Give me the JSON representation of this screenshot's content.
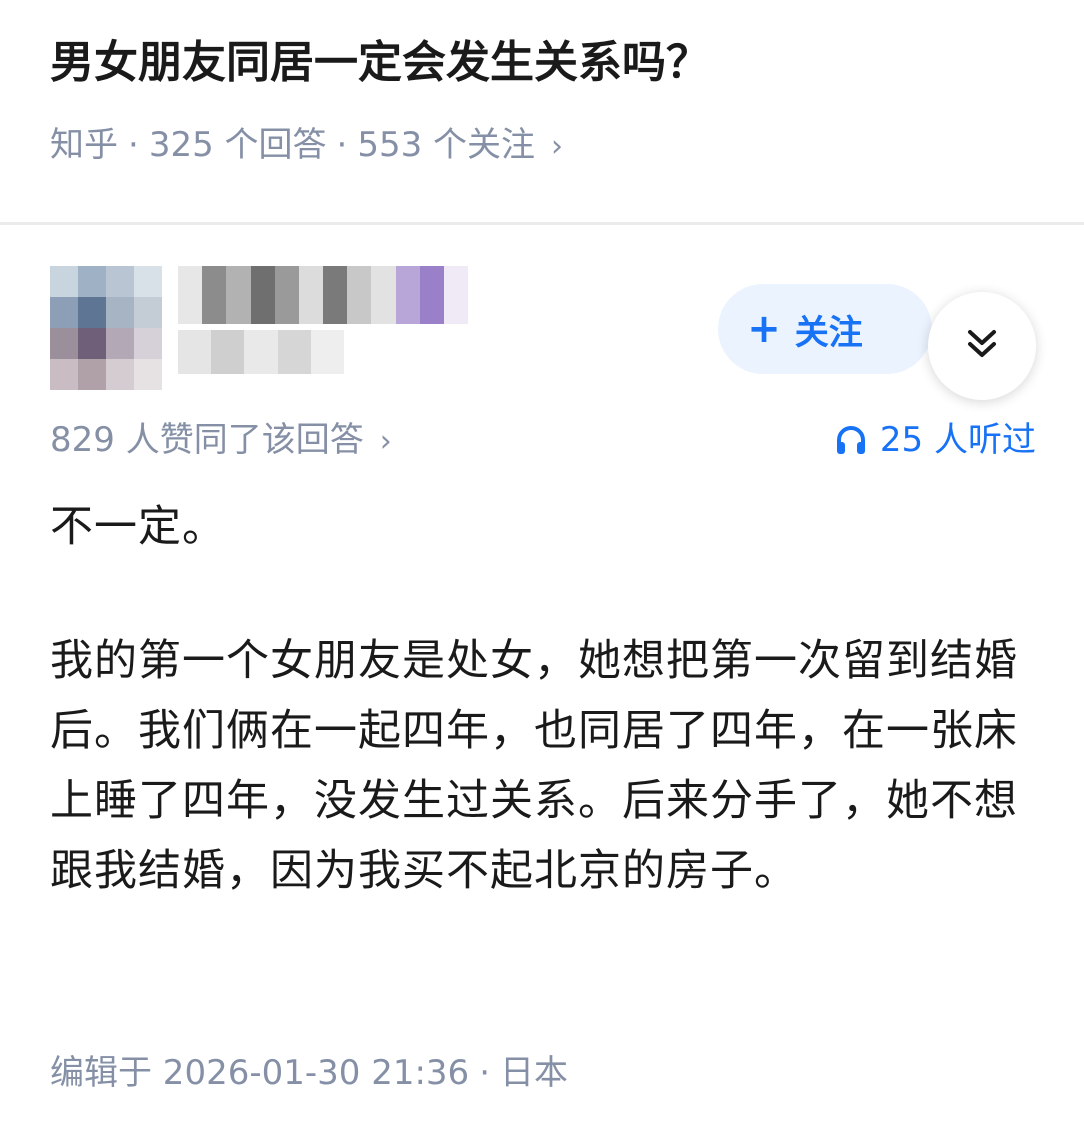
{
  "question": {
    "title": "男女朋友同居一定会发生关系吗？",
    "source": "知乎",
    "answers_count": "325 个回答",
    "followers_count": "553 个关注",
    "separator": "·",
    "chevron": "›"
  },
  "author": {
    "avatar_palette": [
      "#c8d4de",
      "#9fb1c4",
      "#b9c5d2",
      "#d9e1e8",
      "#8c9fb6",
      "#5f7594",
      "#a7b4c4",
      "#c4ccd6",
      "#9b8f9c",
      "#6f5f78",
      "#b3a8b6",
      "#d6d0d8",
      "#c9bcc2",
      "#b0a0a8",
      "#d4ccd0",
      "#e6e2e4"
    ],
    "name_palette": [
      "#e7e7e7",
      "#8c8c8c",
      "#b2b2b2",
      "#6f6f6f",
      "#9a9a9a",
      "#dcdcdc",
      "#7a7a7a",
      "#c8c8c8",
      "#e2e2e2",
      "#b9a6d9",
      "#9a7fc9",
      "#efeaf6"
    ],
    "sub_palette": [
      "#e5e5e5",
      "#cfcfcf",
      "#e9e9e9",
      "#d6d6d6",
      "#eeeeee"
    ]
  },
  "follow_button": {
    "plus": "+",
    "label": "关注",
    "text_color": "#1772f6",
    "bg_color": "#ebf3ff"
  },
  "expand_button": {
    "icon": "chevrons-down-icon"
  },
  "upvote": {
    "text": "829 人赞同了该回答",
    "chevron": "›"
  },
  "listen": {
    "icon": "headphones-icon",
    "text": "25 人听过"
  },
  "answer": {
    "paragraphs": [
      "不一定。",
      "我的第一个女朋友是处女，她想把第一次留到结婚后。我们俩在一起四年，也同居了四年，在一张床上睡了四年，没发生过关系。后来分手了，她不想跟我结婚，因为我买不起北京的房子。"
    ]
  },
  "edit_info": {
    "edited_at": "编辑于 2026-01-30 21:36",
    "separator": "·",
    "location": "日本"
  }
}
